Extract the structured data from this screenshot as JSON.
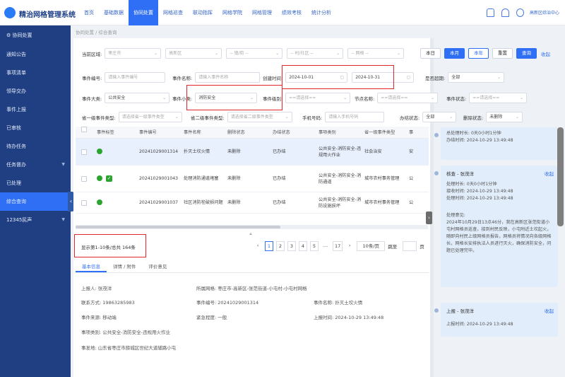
{
  "app": {
    "title": "精治网格管理系统",
    "user": "高新区综治中心"
  },
  "nav": [
    "首页",
    "基础数据",
    "协同处置",
    "网格巡查",
    "联动指挥",
    "网格学院",
    "网格管理",
    "绩效考核",
    "统计分析"
  ],
  "sidebar": {
    "header": "协同处置",
    "items": [
      {
        "label": "通知公告"
      },
      {
        "label": "事项清单"
      },
      {
        "label": "领导交办"
      },
      {
        "label": "事件上报"
      },
      {
        "label": "已审核"
      },
      {
        "label": "待办任务"
      },
      {
        "label": "任务督办"
      },
      {
        "label": "已处理"
      },
      {
        "label": "综合查询"
      },
      {
        "label": "12345民声"
      }
    ]
  },
  "breadcrumb": "协同处置 / 综合查询",
  "filters": {
    "region_label": "当前区域:",
    "region": [
      "枣庄市",
      "高新区",
      "-- 镇/街 --",
      "-- 村/社区 --",
      "-- 网格 --"
    ],
    "period_buttons": [
      "本日",
      "本月",
      "本年",
      "重置"
    ],
    "query": "查询",
    "collapse": "收起",
    "event_no_label": "事件编号:",
    "event_no_ph": "请输入事件编号",
    "event_name_label": "事件名称:",
    "event_name_ph": "请输入事件名称",
    "time_label": "创建时间:",
    "date_from": "2024-10-01",
    "date_to": "2024-10-31",
    "overdue_label": "是否超期:",
    "overdue": "全部",
    "major_label": "事件大类:",
    "major": "公共安全",
    "minor_label": "事件小类:",
    "minor": "消防安全",
    "level_label": "事件级别:",
    "level_ph": "==请选择==",
    "node_label": "节点名称:",
    "node_ph": "==请选择==",
    "status_label": "事件状态:",
    "status_ph": "==请选择==",
    "prov1_label": "省一级事件类型:",
    "prov1_ph": "请选择省一级事件类型",
    "prov2_label": "省二级事件类型:",
    "prov2_ph": "请选择省二级事件类型",
    "phone_label": "手机号码:",
    "phone_ph": "请输入手机号码",
    "done_label": "办结状态:",
    "done": "全部",
    "deleted_label": "删除状态:",
    "deleted": "未删除"
  },
  "table": {
    "headers": [
      "",
      "事件标签",
      "事件编号",
      "事件名称",
      "删除状态",
      "办结状态",
      "事项类别",
      "省一级事件类型",
      "事"
    ],
    "rows": [
      {
        "no": "20241029001314",
        "name": "扑灭土坎火情",
        "deleted": "未删除",
        "done": "已办结",
        "category": "公共安全-消防安全-违规用火作业",
        "prov1": "社会治安",
        "extra": "安"
      },
      {
        "no": "20241029001043",
        "name": "处理消防通道堵塞",
        "deleted": "未删除",
        "done": "已办结",
        "category": "公共安全-消防安全-消防通道",
        "prov1": "城市农村事务管理",
        "extra": "公"
      },
      {
        "no": "20241029001037",
        "name": "社区消防栓破损问题",
        "deleted": "未删除",
        "done": "已办结",
        "category": "公共安全-消防安全-消防设施损坏",
        "prov1": "城市农村事务管理",
        "extra": "公"
      }
    ]
  },
  "pager": {
    "info": "显示第1-10条/总共 164条",
    "pages": [
      "1",
      "2",
      "3",
      "4",
      "5",
      "…",
      "17"
    ],
    "size": "10条/页",
    "goto": "跳至",
    "unit": "页"
  },
  "tabs": [
    "基本信息",
    "详情 / 附件",
    "评价意见"
  ],
  "detail": {
    "reporter_l": "上报人:",
    "reporter": "张茂洋",
    "grid_l": "所属网格:",
    "grid": "枣庄市-高新区-张范街道-小屯村-小屯村网格",
    "phone_l": "联系方式:",
    "phone": "19863285983",
    "no_l": "事件编号:",
    "no": "20241029001314",
    "name_l": "事件名称:",
    "name": "扑灭土坎火情",
    "source_l": "事件来源:",
    "source": "移动端",
    "urgency_l": "紧急程度:",
    "urgency": "一般",
    "time_l": "上报时间:",
    "time": "2024-10-29 13:49:48",
    "type_l": "事项类别:",
    "type": "公共安全-消防安全-违规用火作业",
    "place_l": "事发地:",
    "place": "山东省枣庄市薛城区世纪大道辅路小屯"
  },
  "timeline": [
    {
      "lines": [
        "总处理时长: 0天0小时1分钟",
        "办结时间: 2024-10-29 13:49:48"
      ]
    },
    {
      "title": "核查 - 张茂洋",
      "toggle": "收起",
      "lines": [
        "处理时长: 0天0小时1分钟",
        "接收时间: 2024-10-29 13:49:48",
        "处理时间: 2024-10-29 13:49:48",
        "",
        "处理意见:",
        "2024年10月29日13点46分，我在高新区张范街道小屯村网格员巡查，接到村民反映，小屯附近土坎起火，随即向村民上级网格员报告，网格员将情况向各级网格长，网格长安排执法人员进行灭火，确保消防安全，问题已处理完毕。"
      ]
    },
    {
      "title": "上报 - 张茂洋",
      "toggle": "收起",
      "lines": [
        "上报时间: 2024-10-29 13:49:48"
      ]
    }
  ]
}
